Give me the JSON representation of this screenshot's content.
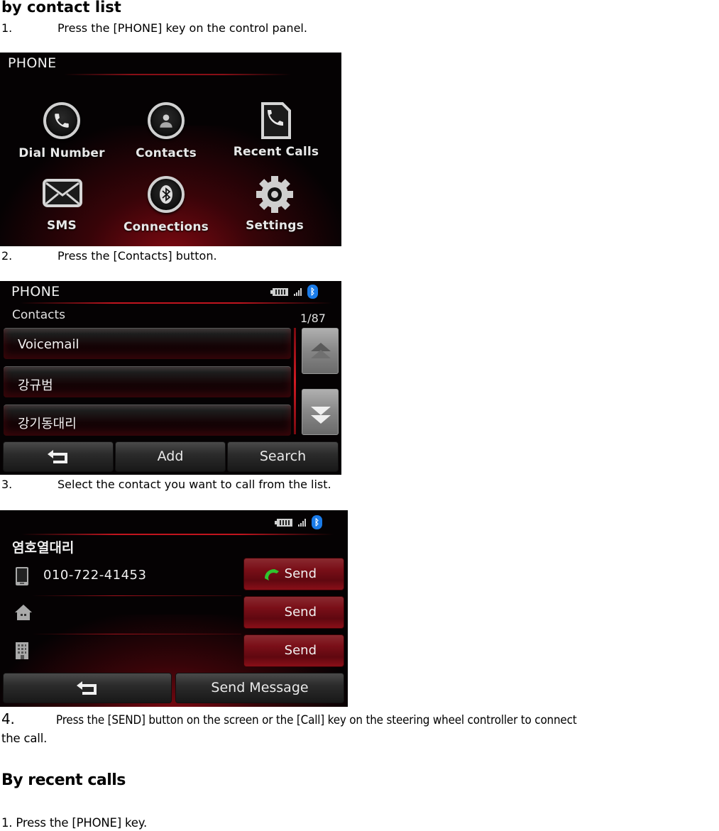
{
  "section1": {
    "title": "by contact list",
    "steps": [
      {
        "num": "1.",
        "text": "Press the [PHONE] key on the control panel."
      },
      {
        "num": "2.",
        "text": "Press the [Contacts] button."
      },
      {
        "num": "3.",
        "text": "Select the contact you want to call from the list."
      },
      {
        "num": "4.",
        "text": "Press the [SEND] button on the screen or the [Call] key on the steering wheel controller to connect",
        "text_cont": "the call."
      }
    ]
  },
  "section2": {
    "title": "By recent calls",
    "steps": [
      {
        "text": "1. Press the [PHONE] key."
      }
    ]
  },
  "screen_phone_menu": {
    "header": "PHONE",
    "items": [
      {
        "label": "Dial Number",
        "icon": "phone-circle-icon"
      },
      {
        "label": "Contacts",
        "icon": "contacts-icon"
      },
      {
        "label": "Recent Calls",
        "icon": "recent-calls-icon"
      },
      {
        "label": "SMS",
        "icon": "envelope-icon"
      },
      {
        "label": "Connections",
        "icon": "bluetooth-icon"
      },
      {
        "label": "Settings",
        "icon": "gear-icon"
      }
    ]
  },
  "screen_contacts": {
    "header": "PHONE",
    "subheader": "Contacts",
    "page_indicator": "1/87",
    "contacts": [
      "Voicemail",
      "강규범",
      "강기동대리"
    ],
    "buttons": {
      "back": "back-arrow",
      "add": "Add",
      "search": "Search"
    }
  },
  "screen_contact_detail": {
    "name": "염호열대리",
    "numbers": [
      {
        "type": "mobile",
        "value": "010-722-41453",
        "button": "Send"
      },
      {
        "type": "home",
        "value": "",
        "button": "Send"
      },
      {
        "type": "office",
        "value": "",
        "button": "Send"
      }
    ],
    "buttons": {
      "back": "back-arrow",
      "send_message": "Send Message"
    }
  },
  "colors": {
    "accent_red": "#c0141e",
    "bluetooth_blue": "#1a7be8",
    "call_green": "#2ec62e"
  }
}
